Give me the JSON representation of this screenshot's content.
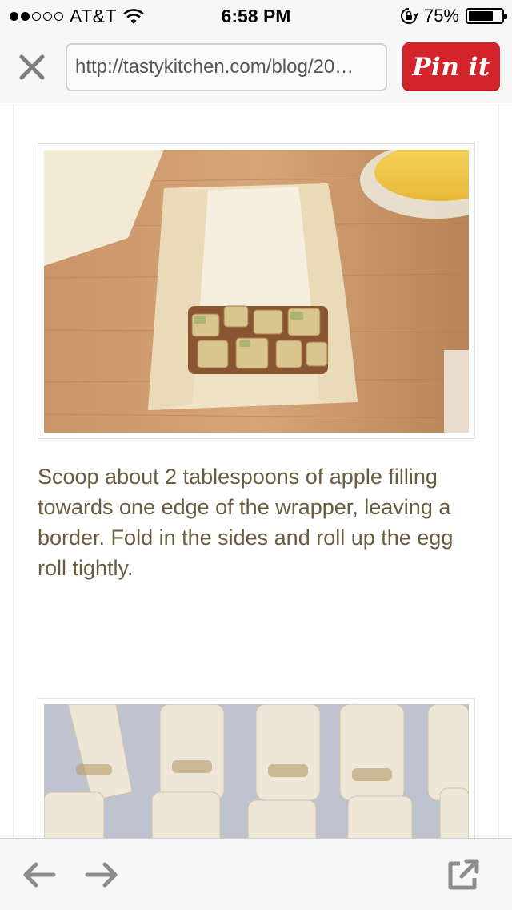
{
  "status_bar": {
    "carrier": "AT&T",
    "time": "6:58 PM",
    "battery_percent": "75%",
    "battery_level": 0.75,
    "signal_bars_filled": 2,
    "signal_bars_total": 5
  },
  "toolbar": {
    "url": "http://tastykitchen.com/blog/20…",
    "pin_label": "Pin it",
    "pin_color": "#d2242a"
  },
  "content": {
    "caption": "Scoop about 2 tablespoons of apple filling towards one edge of the wrapper, leaving a border. Fold in the sides and roll up the egg roll tightly.",
    "caption_color": "#6b5b3e"
  },
  "icons": {
    "close": "close-icon",
    "back": "arrow-left-icon",
    "forward": "arrow-right-icon",
    "share": "open-external-icon",
    "wifi": "wifi-icon",
    "rotation_lock": "rotation-lock-icon",
    "battery": "battery-icon"
  }
}
